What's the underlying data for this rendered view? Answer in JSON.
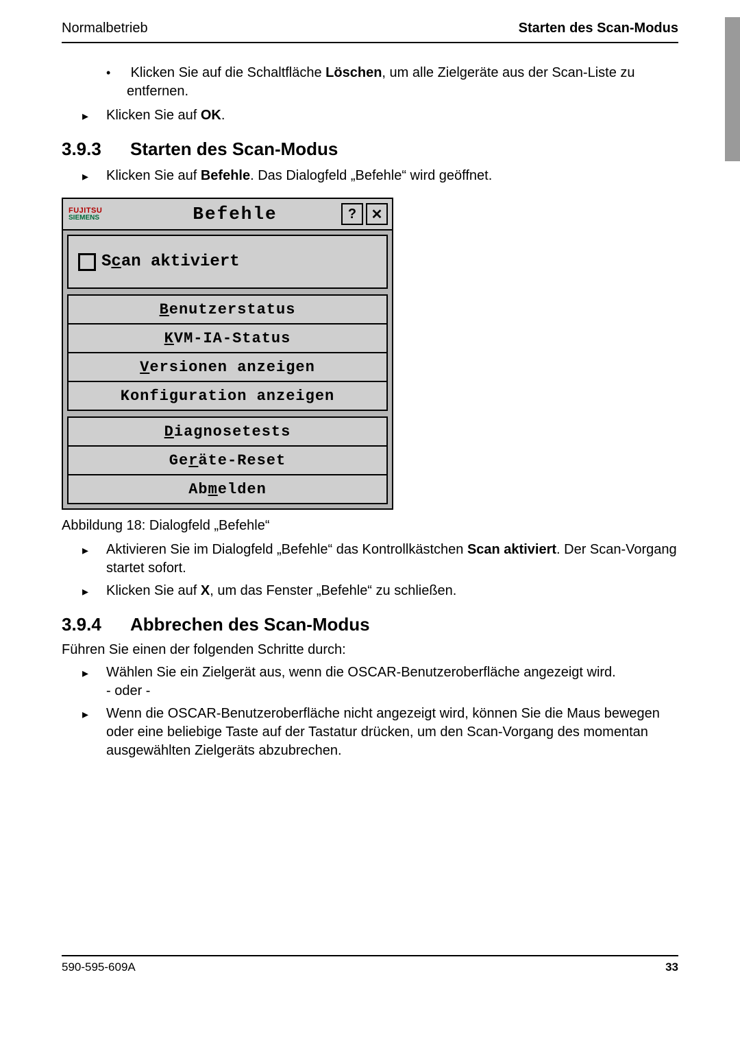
{
  "header": {
    "left": "Normalbetrieb",
    "right": "Starten des Scan-Modus"
  },
  "pre_bullets": {
    "dot": {
      "t1": "Klicken Sie auf die Schaltfläche ",
      "b1": "Löschen",
      "t2": ", um alle Zielgeräte aus der Scan-Liste zu entfernen."
    },
    "arrow_ok": {
      "t1": "Klicken Sie auf ",
      "b1": "OK",
      "t2": "."
    }
  },
  "sec393": {
    "num": "3.9.3",
    "title": "Starten des Scan-Modus",
    "arrow1": {
      "t1": "Klicken Sie auf ",
      "b1": "Befehle",
      "t2": ". Das Dialogfeld „Befehle“ wird geöffnet."
    }
  },
  "dialog": {
    "logo": {
      "line1": "FUJITSU",
      "line2": "SIEMENS"
    },
    "title": "Befehle",
    "help": "?",
    "close": "✕",
    "checkbox_label": {
      "pre": "S",
      "ul": "c",
      "post": "an aktiviert"
    },
    "group1": [
      {
        "pre": "",
        "ul": "B",
        "post": "enutzerstatus"
      },
      {
        "pre": "",
        "ul": "K",
        "post": "VM-IA-Status"
      },
      {
        "pre": "",
        "ul": "V",
        "post": "ersionen anzeigen"
      },
      {
        "pre": "Konfi",
        "ul": "g",
        "post": "uration anzeigen"
      }
    ],
    "group2": [
      {
        "pre": "",
        "ul": "D",
        "post": "iagnosetests"
      },
      {
        "pre": "Ge",
        "ul": "r",
        "post": "äte-Reset"
      },
      {
        "pre": "Ab",
        "ul": "m",
        "post": "elden"
      }
    ]
  },
  "caption": "Abbildung 18: Dialogfeld „Befehle“",
  "post_arrows": {
    "a1": {
      "t1": "Aktivieren Sie im Dialogfeld „Befehle“ das Kontrollkästchen ",
      "b1": "Scan aktiviert",
      "t2": ". Der Scan-Vorgang startet sofort."
    },
    "a2": {
      "t1": "Klicken Sie auf ",
      "b1": "X",
      "t2": ", um das Fenster „Befehle“ zu schließen."
    }
  },
  "sec394": {
    "num": "3.9.4",
    "title": "Abbrechen des Scan-Modus",
    "intro": "Führen Sie einen der folgenden Schritte durch:",
    "arrows": {
      "a1": {
        "t1": "Wählen Sie ein Zielgerät aus, wenn die OSCAR-Benutzeroberfläche angezeigt wird.",
        "t2": "- oder -"
      },
      "a2": "Wenn die OSCAR-Benutzeroberfläche nicht angezeigt wird, können Sie die Maus bewegen oder eine beliebige Taste auf der Tastatur drücken, um den Scan-Vorgang des momentan ausgewählten Zielgeräts abzubrechen."
    }
  },
  "footer": {
    "docnum": "590-595-609A",
    "page": "33"
  }
}
